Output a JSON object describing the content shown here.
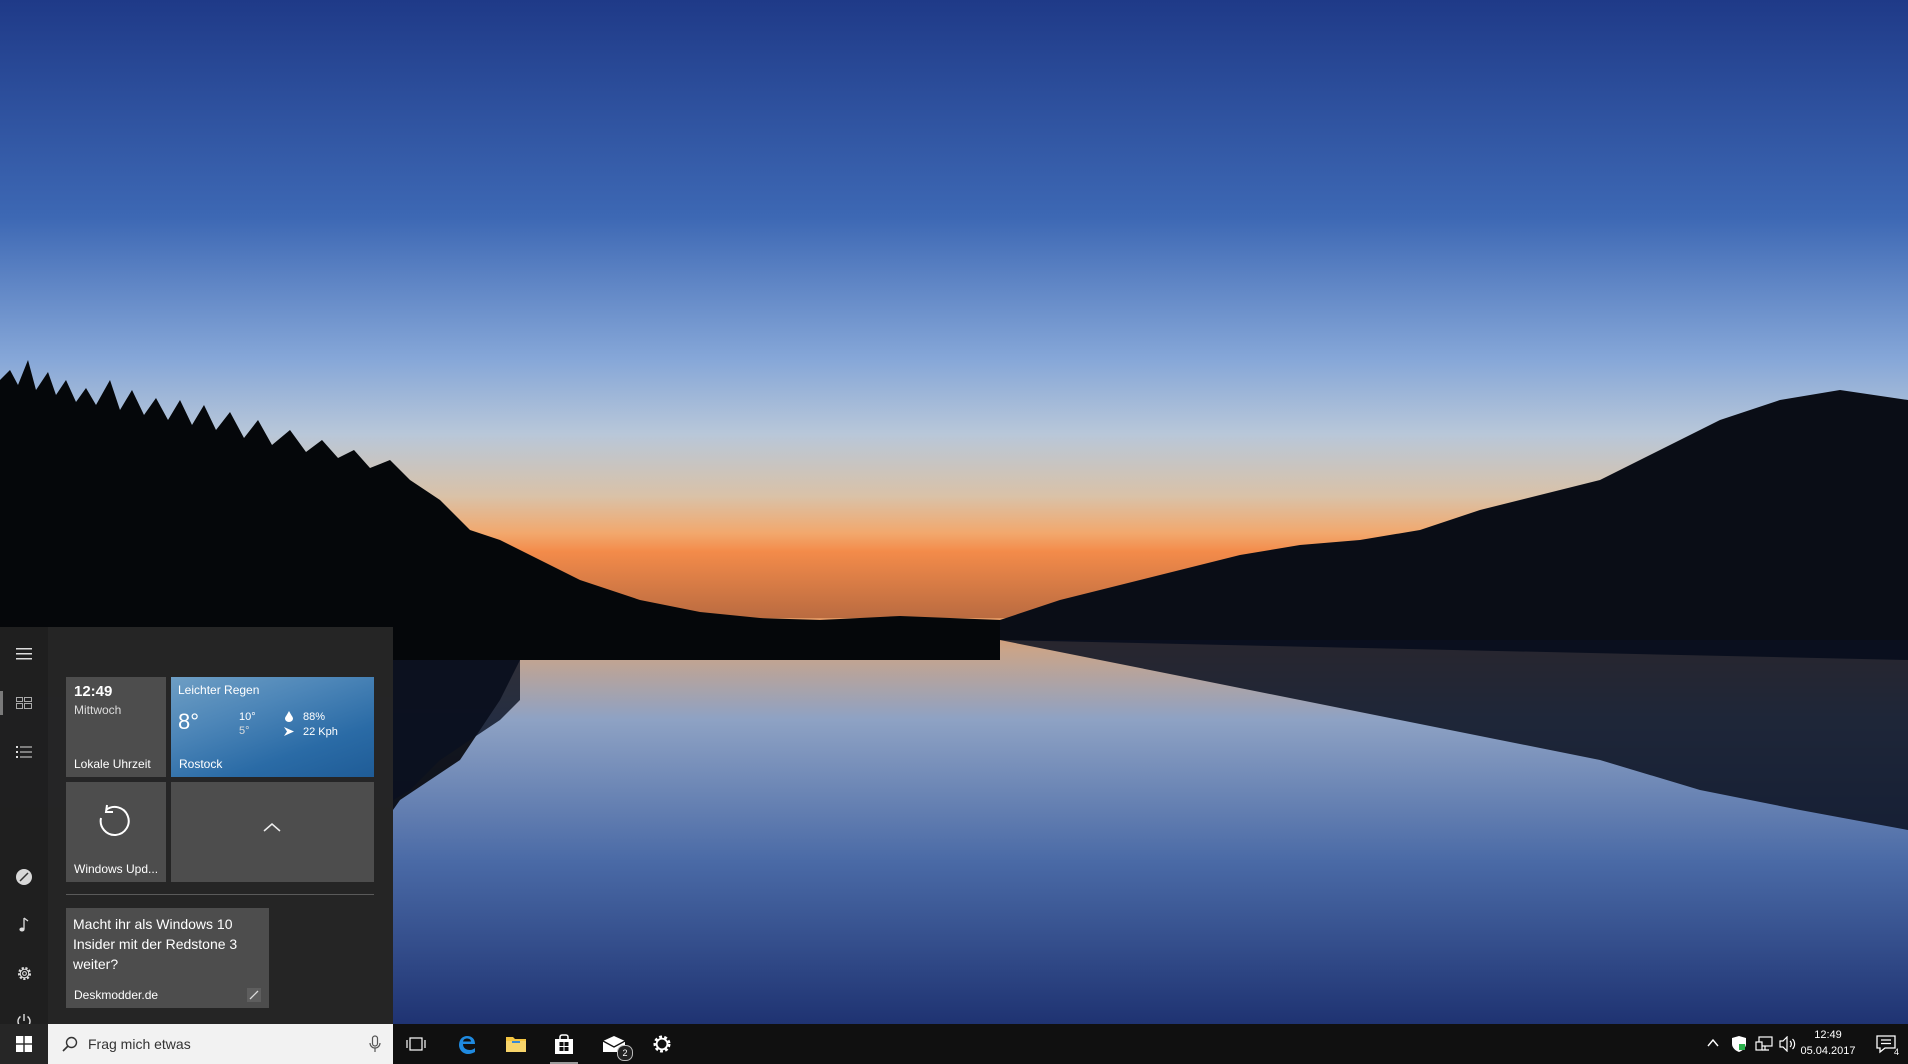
{
  "start_menu": {
    "tiles": {
      "clock": {
        "time": "12:49",
        "day": "Mittwoch",
        "label": "Lokale Uhrzeit"
      },
      "weather": {
        "condition": "Leichter Regen",
        "temp": "8°",
        "high": "10°",
        "low": "5°",
        "humidity": "88%",
        "wind": "22 Kph",
        "city": "Rostock"
      },
      "update": {
        "label": "Windows Upd..."
      },
      "news": {
        "text": "Macht ihr als Windows 10 Insider mit der Redstone 3 weiter?",
        "source": "Deskmodder.de"
      }
    }
  },
  "taskbar": {
    "search": {
      "placeholder": "Frag mich etwas"
    },
    "mail_badge": "2",
    "clock": {
      "time": "12:49",
      "date": "05.04.2017"
    },
    "notification_count": "4"
  }
}
